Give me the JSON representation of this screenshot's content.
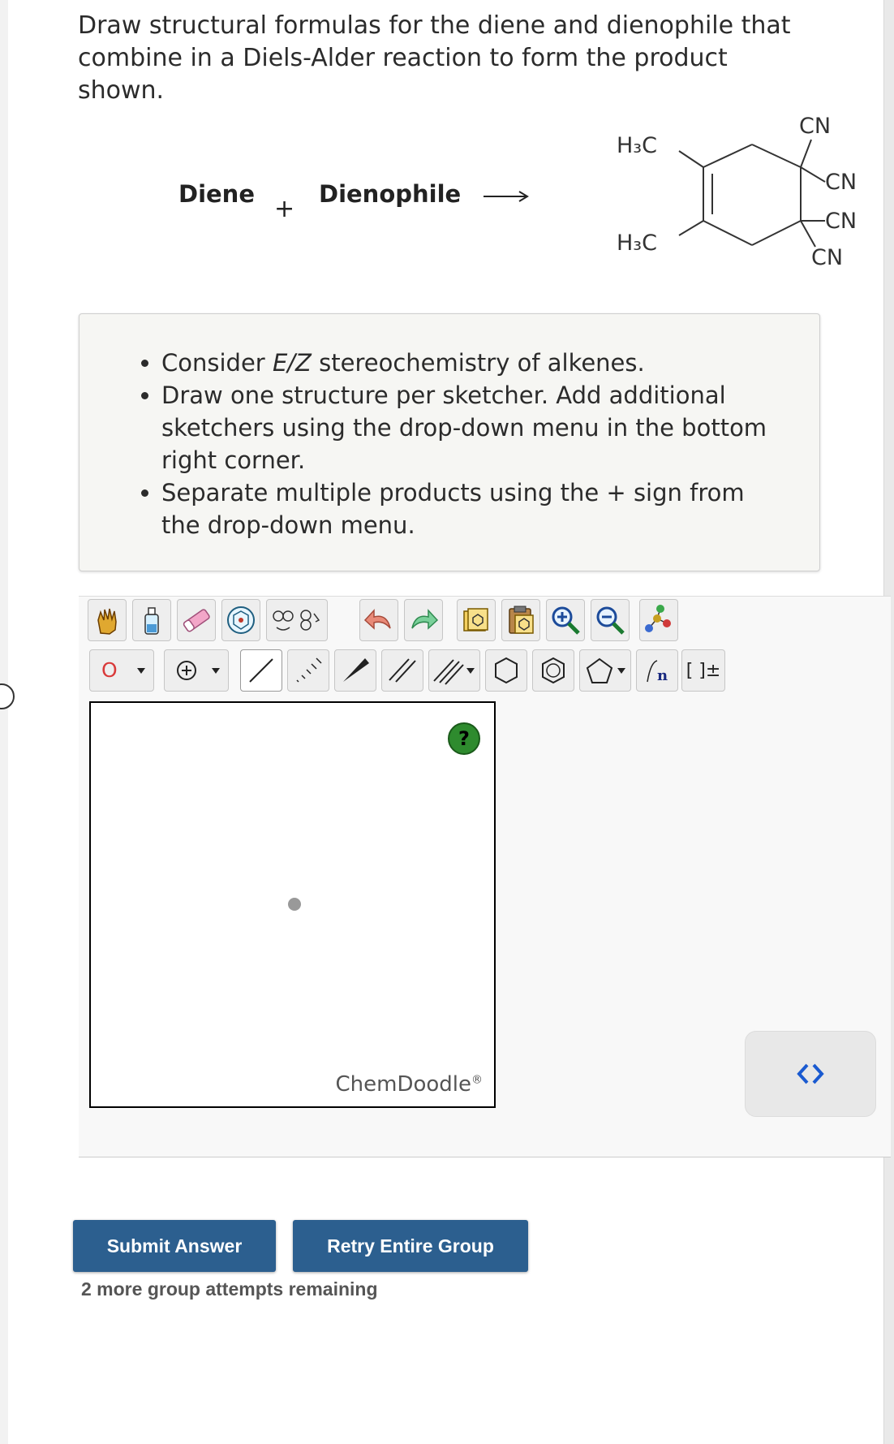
{
  "question": {
    "line1": "Draw structural formulas for the diene and dienophile that",
    "line2": "combine in a Diels-Alder reaction to form the product shown."
  },
  "equation": {
    "diene_label": "Diene",
    "plus": "+",
    "dienophile_label": "Dienophile"
  },
  "product": {
    "methyl_top": "H₃C",
    "methyl_bottom": "H₃C",
    "cn_1": "CN",
    "cn_2": "CN",
    "cn_3": "CN",
    "cn_4": "CN"
  },
  "hints": [
    "Consider E/Z stereochemistry of alkenes.",
    "Draw one structure per sketcher. Add additional sketchers using the drop-down menu in the bottom right corner.",
    "Separate multiple products using the + sign from the drop-down menu."
  ],
  "toolbar": {
    "atom_label": "O",
    "bracket_label": "[ ]±",
    "icons_row1": [
      "hand-icon",
      "bottle-icon",
      "eraser-icon",
      "ring-template-icon",
      "rings-icon",
      "rotate-icon",
      "undo-icon",
      "redo-icon",
      "cut-icon",
      "paste-icon",
      "zoom-in-icon",
      "zoom-out-icon",
      "clean-icon"
    ],
    "icons_row2": [
      "atom-o-dropdown",
      "charge-plus-dropdown",
      "single-bond-icon",
      "wedge-dashed-icon",
      "wedge-bold-icon",
      "double-bond-icon",
      "triple-bond-dropdown",
      "cyclohexane-icon",
      "benzene-icon",
      "cyclopentane-dropdown",
      "polymer-icon",
      "bracket-charge-icon"
    ]
  },
  "sketcher": {
    "help": "?",
    "logo": "ChemDoodle",
    "logo_mark": "®"
  },
  "buttons": {
    "submit": "Submit Answer",
    "retry": "Retry Entire Group"
  },
  "attempts": "2 more group attempts remaining",
  "colors": {
    "button_blue": "#2c5f8f",
    "help_green": "#2e8b2e",
    "hint_bg": "#f6f6f3"
  }
}
